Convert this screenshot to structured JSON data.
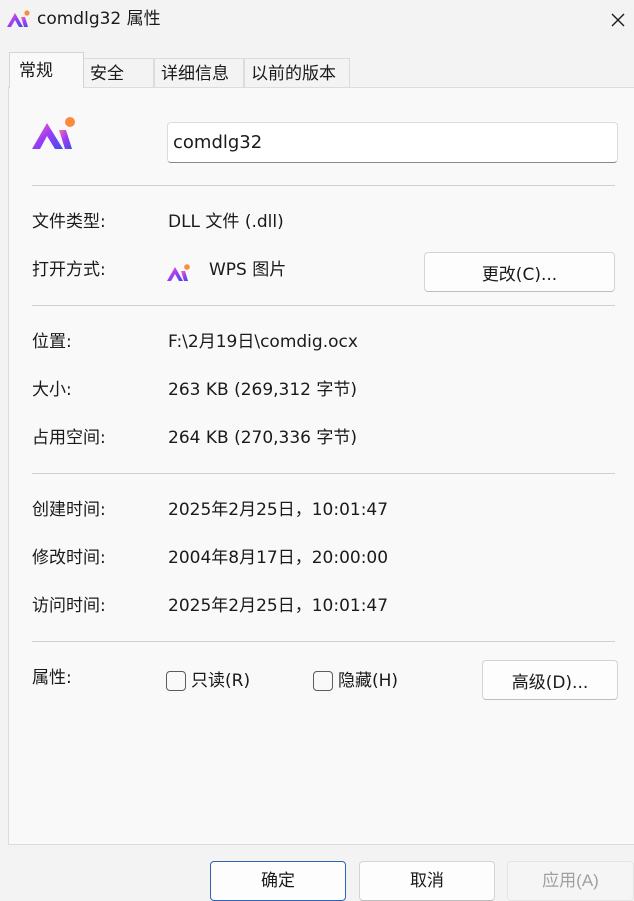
{
  "window": {
    "title": "comdlg32 属性"
  },
  "tabs": [
    {
      "label": "常规",
      "active": true
    },
    {
      "label": "安全",
      "active": false
    },
    {
      "label": "详细信息",
      "active": false
    },
    {
      "label": "以前的版本",
      "active": false
    }
  ],
  "general": {
    "file_name": "comdlg32",
    "file_type_label": "文件类型:",
    "file_type_value": "DLL 文件 (.dll)",
    "open_with_label": "打开方式:",
    "open_with_value": "WPS 图片",
    "change_button": "更改(C)...",
    "location_label": "位置:",
    "location_value": "F:\\2月19日\\comdig.ocx",
    "size_label": "大小:",
    "size_value": "263 KB (269,312 字节)",
    "size_on_disk_label": "占用空间:",
    "size_on_disk_value": "264 KB (270,336 字节)",
    "created_label": "创建时间:",
    "created_value": "2025年2月25日，10:01:47",
    "modified_label": "修改时间:",
    "modified_value": "2004年8月17日，20:00:00",
    "accessed_label": "访问时间:",
    "accessed_value": "2025年2月25日，10:01:47",
    "attributes_label": "属性:",
    "readonly_label": "只读(R)",
    "readonly_checked": false,
    "hidden_label": "隐藏(H)",
    "hidden_checked": false,
    "advanced_button": "高级(D)..."
  },
  "footer": {
    "ok_label": "确定",
    "cancel_label": "取消",
    "apply_label": "应用(A)"
  },
  "icons": {
    "app_icon": "wps-pictures-icon",
    "close_icon": "close-icon"
  },
  "colors": {
    "icon_gradient_start": "#ff5a8a",
    "icon_gradient_mid": "#9b3cf5",
    "icon_gradient_end": "#3b4cf0",
    "primary_border": "#2b63b8"
  }
}
